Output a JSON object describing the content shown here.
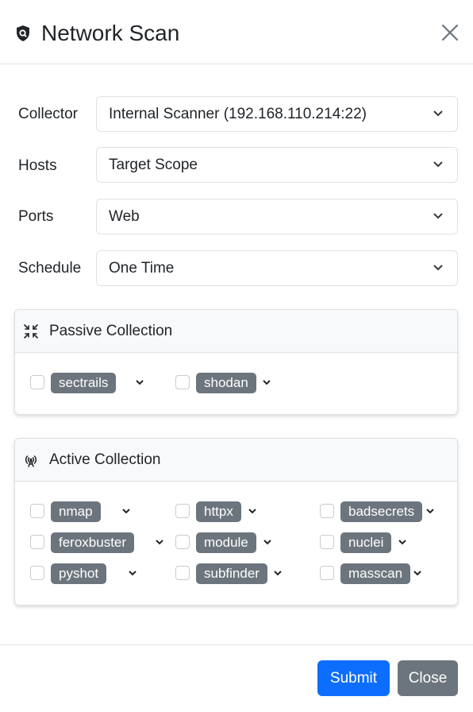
{
  "modal": {
    "title": "Network Scan",
    "icon": "shield-scan-icon",
    "close_icon": "close-icon"
  },
  "form": {
    "collector": {
      "label": "Collector",
      "value": "Internal Scanner (192.168.110.214:22)"
    },
    "hosts": {
      "label": "Hosts",
      "value": "Target Scope"
    },
    "ports": {
      "label": "Ports",
      "value": "Web"
    },
    "schedule": {
      "label": "Schedule",
      "value": "One Time"
    }
  },
  "passive": {
    "title": "Passive Collection",
    "icon": "compress-arrows-icon",
    "modules": [
      {
        "name": "sectrails",
        "checked": false
      },
      {
        "name": "shodan",
        "checked": false
      }
    ]
  },
  "active": {
    "title": "Active Collection",
    "icon": "broadcast-tower-icon",
    "modules": [
      {
        "name": "nmap",
        "checked": false
      },
      {
        "name": "httpx",
        "checked": false
      },
      {
        "name": "badsecrets",
        "checked": false
      },
      {
        "name": "feroxbuster",
        "checked": false
      },
      {
        "name": "module",
        "checked": false
      },
      {
        "name": "nuclei",
        "checked": false
      },
      {
        "name": "pyshot",
        "checked": false
      },
      {
        "name": "subfinder",
        "checked": false
      },
      {
        "name": "masscan",
        "checked": false
      }
    ]
  },
  "footer": {
    "submit_label": "Submit",
    "close_label": "Close"
  },
  "colors": {
    "primary": "#0d6efd",
    "secondary": "#6c757d",
    "border": "#dee2e6",
    "card_header_bg": "#f8f9fa"
  }
}
